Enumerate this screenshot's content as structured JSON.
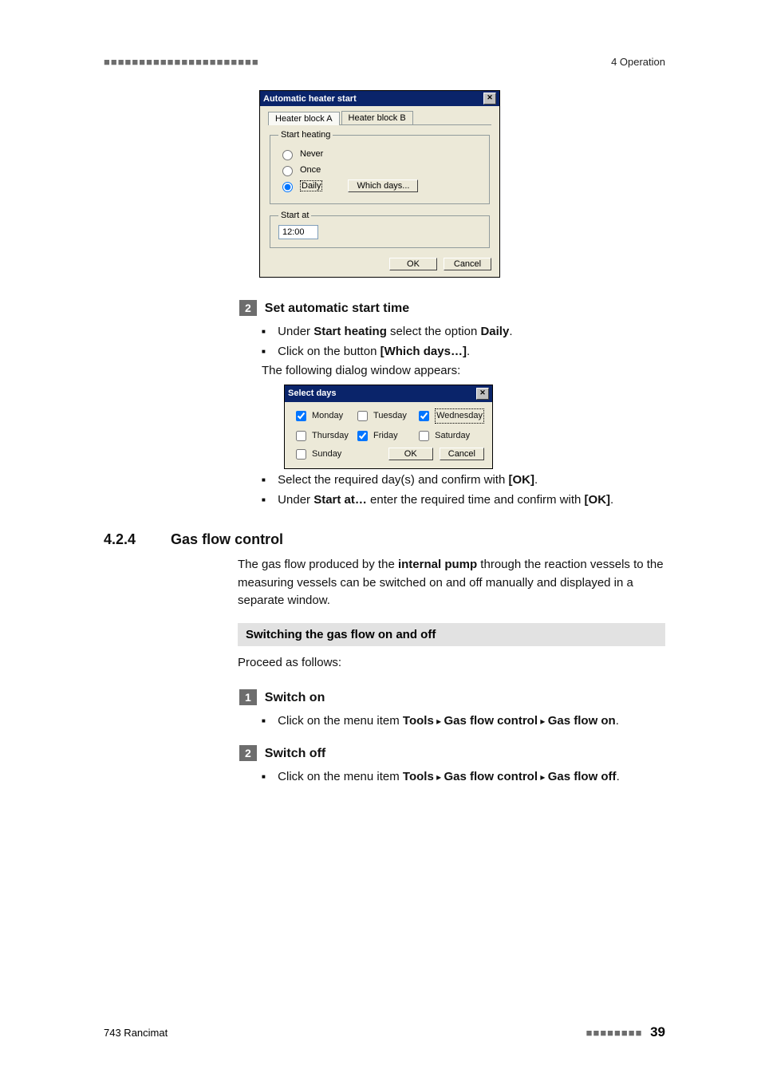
{
  "header": {
    "dashes": "■■■■■■■■■■■■■■■■■■■■■■",
    "right": "4 Operation"
  },
  "dialog1": {
    "title": "Automatic heater start",
    "close": "✕",
    "tabs": {
      "a": "Heater block A",
      "b": "Heater block B"
    },
    "group1_legend": "Start heating",
    "opt_never": "Never",
    "opt_once": "Once",
    "opt_daily": "Daily",
    "btn_whichdays": "Which days...",
    "group2_legend": "Start at",
    "time_value": "12:00",
    "ok": "OK",
    "cancel": "Cancel"
  },
  "step2": {
    "num": "2",
    "title": "Set automatic start time",
    "b1_pre": "Under ",
    "b1_bold": "Start heating",
    "b1_post": " select the option ",
    "b1_bold2": "Daily",
    "b1_end": ".",
    "b2_pre": "Click on the button ",
    "b2_bold": "[Which days…]",
    "b2_end": ".",
    "b2_line2": "The following dialog window appears:"
  },
  "dialog2": {
    "title": "Select days",
    "close": "✕",
    "monday": "Monday",
    "tuesday": "Tuesday",
    "wednesday": "Wednesday",
    "thursday": "Thursday",
    "friday": "Friday",
    "saturday": "Saturday",
    "sunday": "Sunday",
    "ok": "OK",
    "cancel": "Cancel"
  },
  "step2_after": {
    "b3_pre": "Select the required day(s) and confirm with ",
    "b3_bold": "[OK]",
    "b3_end": ".",
    "b4_pre": "Under ",
    "b4_bold": "Start at…",
    "b4_mid": " enter the required time and confirm with ",
    "b4_bold2": "[OK]",
    "b4_end": "."
  },
  "section": {
    "num": "4.2.4",
    "title": "Gas flow control",
    "para_pre": "The gas flow produced by the ",
    "para_bold": "internal pump",
    "para_post": " through the reaction vessels to the measuring vessels can be switched on and off manually and displayed in a separate window.",
    "bar": "Switching the gas flow on and off",
    "proceed": "Proceed as follows:"
  },
  "stepA": {
    "num": "1",
    "title": "Switch on",
    "b_pre": "Click on the menu item ",
    "tools": "Tools",
    "arrow": " ▸ ",
    "gfc": "Gas flow control",
    "gfon": "Gas flow on",
    "end": "."
  },
  "stepB": {
    "num": "2",
    "title": "Switch off",
    "b_pre": "Click on the menu item ",
    "tools": "Tools",
    "arrow": " ▸ ",
    "gfc": "Gas flow control",
    "gfoff": "Gas flow off",
    "end": "."
  },
  "footer": {
    "left": "743 Rancimat",
    "dashes": "■■■■■■■■",
    "page": "39"
  }
}
